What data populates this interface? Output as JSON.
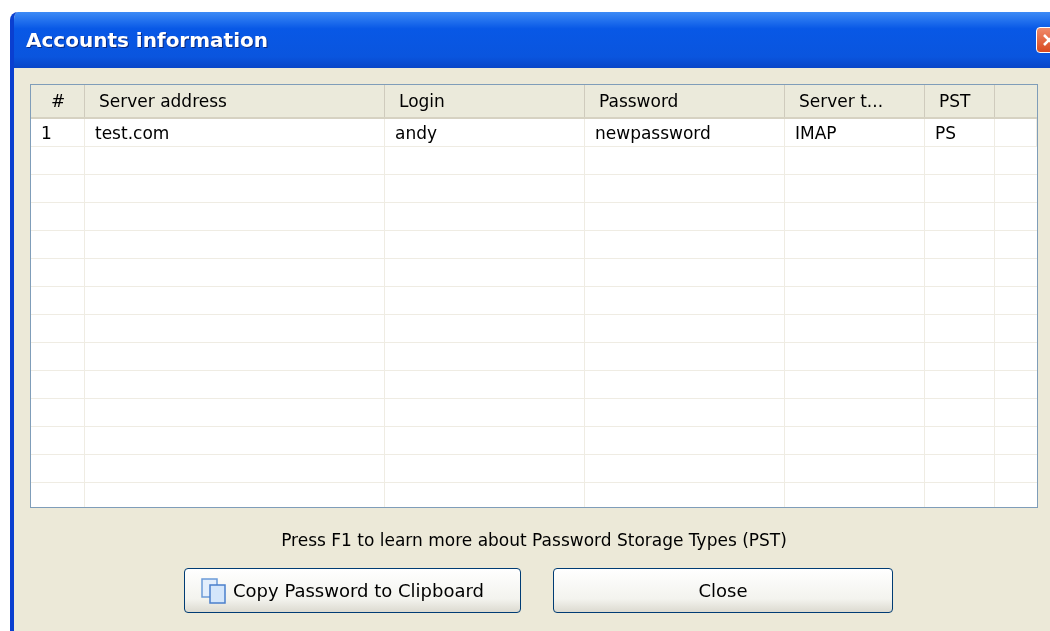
{
  "window": {
    "title": "Accounts information"
  },
  "table": {
    "columns": [
      "#",
      "Server address",
      "Login",
      "Password",
      "Server t...",
      "PST"
    ],
    "rows": [
      {
        "cells": [
          "1",
          "test.com",
          "andy",
          "newpassword",
          "IMAP",
          "PS"
        ],
        "selected": false
      }
    ]
  },
  "hint": "Press F1 to learn more about Password Storage Types (PST)",
  "buttons": [
    {
      "kind": "copy",
      "label": "Copy Password to Clipboard"
    },
    {
      "kind": "plain",
      "label": "Close"
    }
  ]
}
